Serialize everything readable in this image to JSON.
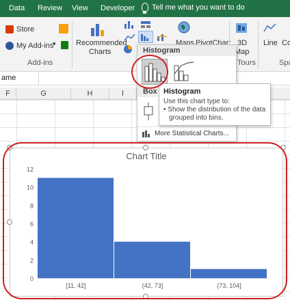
{
  "ribbon_tabs": [
    "Data",
    "Review",
    "View",
    "Developer"
  ],
  "tell_me": "Tell me what you want to do",
  "addins": {
    "store": "Store",
    "my_addins": "My Add-ins",
    "group_label": "Add-ins"
  },
  "charts_group": {
    "recommended_line1": "Recommended",
    "recommended_line2": "Charts",
    "maps": "Maps",
    "pivotchart": "PivotChart"
  },
  "tours_group": {
    "map3d_line1": "3D",
    "map3d_line2": "Map",
    "label": "Tours"
  },
  "sparklines": {
    "line": "Line",
    "column_partial": "Co",
    "label_partial": "Spar"
  },
  "name_box_partial": "ame",
  "columns": [
    "F",
    "G",
    "H",
    "I"
  ],
  "dropdown": {
    "histogram_header": "Histogram",
    "box_header_partial": "Box",
    "more_link": "More Statistical Charts..."
  },
  "tooltip": {
    "title": "Histogram",
    "line1": "Use this chart type to:",
    "line2": "• Show the distribution of the data",
    "line3": "grouped into bins."
  },
  "colors": {
    "ribbon_green": "#217346",
    "bar_blue": "#4472c4",
    "highlight_red": "#cc1f1f"
  },
  "chart_data": {
    "type": "bar",
    "title": "Chart Title",
    "categories": [
      "[11, 42]",
      "(42, 73]",
      "(73, 104]"
    ],
    "values": [
      11,
      4,
      1
    ],
    "ylim": [
      0,
      12
    ],
    "yticks": [
      0,
      2,
      4,
      6,
      8,
      10,
      12
    ],
    "gap": "none",
    "grid": false
  }
}
